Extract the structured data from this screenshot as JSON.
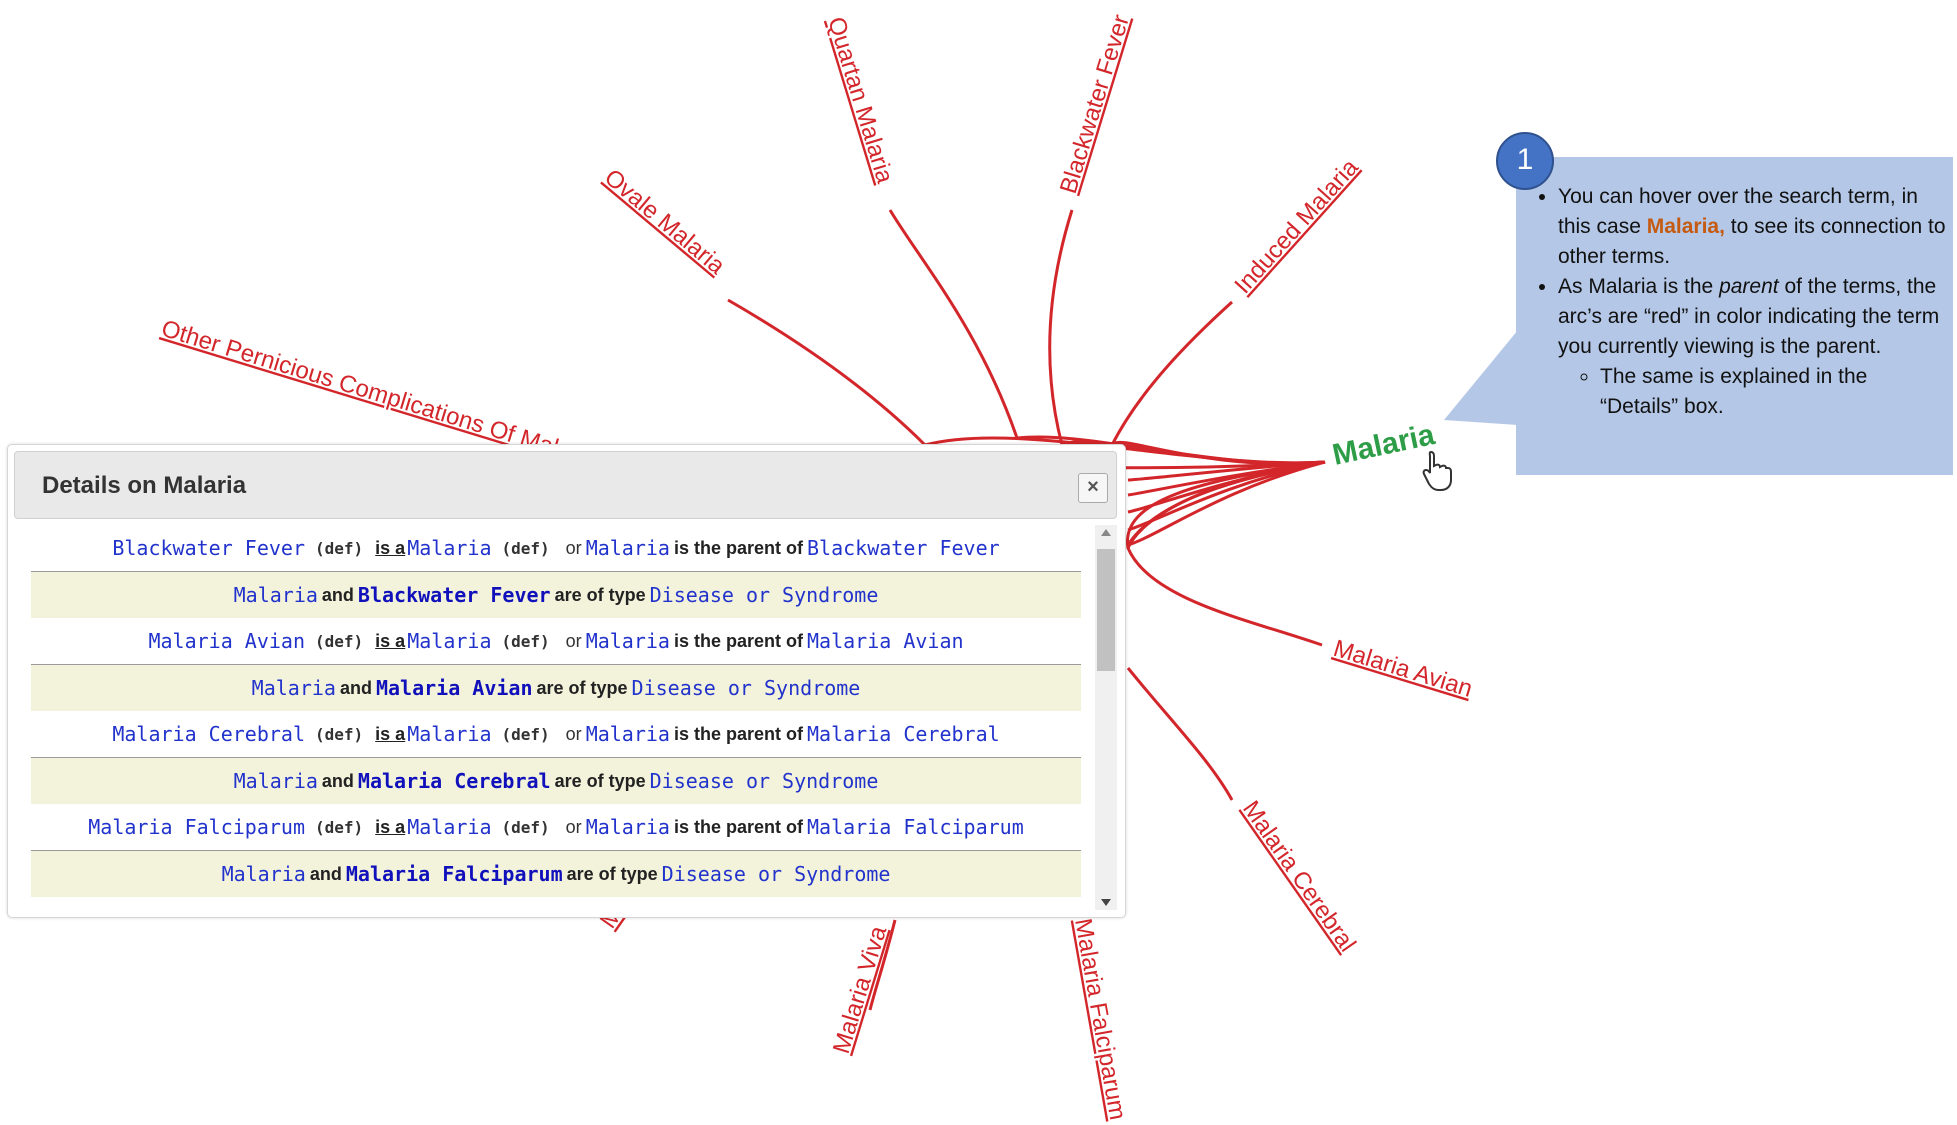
{
  "graph": {
    "center": "Malaria",
    "nodes": [
      "Quartan Malaria",
      "Blackwater Fever",
      "Induced Malaria",
      "Ovale Malaria",
      "Other Pernicious Complications Of Mala",
      "Malaria Avian",
      "Malaria Cerebral",
      "Malaria Falciparum",
      "Malaria Viva",
      "M"
    ],
    "edge_color": "#d3262b",
    "center_color": "#2e9d47"
  },
  "details": {
    "title": "Details on Malaria",
    "close": "×",
    "rows": [
      {
        "a": "Blackwater Fever",
        "def": "(def)",
        "rel": "is a",
        "b": "Malaria",
        "def2": "(def)",
        "or": "or",
        "c": "Malaria",
        "parent": "is the parent of",
        "d": "Blackwater Fever"
      },
      {
        "a": "Malaria",
        "and": "and",
        "b": "Blackwater Fever",
        "type": "are of type",
        "c": "Disease or Syndrome"
      },
      {
        "a": "Malaria Avian",
        "def": "(def)",
        "rel": "is a",
        "b": "Malaria",
        "def2": "(def)",
        "or": "or",
        "c": "Malaria",
        "parent": "is the parent of",
        "d": "Malaria Avian"
      },
      {
        "a": "Malaria",
        "and": "and",
        "b": "Malaria Avian",
        "type": "are of type",
        "c": "Disease or Syndrome"
      },
      {
        "a": "Malaria Cerebral",
        "def": "(def)",
        "rel": "is a",
        "b": "Malaria",
        "def2": "(def)",
        "or": "or",
        "c": "Malaria",
        "parent": "is the parent of",
        "d": "Malaria Cerebral"
      },
      {
        "a": "Malaria",
        "and": "and",
        "b": "Malaria Cerebral",
        "type": "are of type",
        "c": "Disease or Syndrome"
      },
      {
        "a": "Malaria Falciparum",
        "def": "(def)",
        "rel": "is a",
        "b": "Malaria",
        "def2": "(def)",
        "or": "or",
        "c": "Malaria",
        "parent": "is the parent of",
        "d": "Malaria Falciparum"
      },
      {
        "a": "Malaria",
        "and": "and",
        "b": "Malaria Falciparum",
        "type": "are of type",
        "c": "Disease or Syndrome"
      }
    ]
  },
  "callout": {
    "number": "1",
    "b1_pre": "You can hover over the search term, in this case ",
    "b1_hl": "Malaria,",
    "b1_post": " to see its connection to other terms.",
    "b2_pre": "As Malaria is the ",
    "b2_em": "parent",
    "b2_post": " of the terms, the arc’s are “red” in color indicating the term you currently viewing is the parent.",
    "b3": "The same is explained in the “Details” box.",
    "bg_color": "#b4c7e7"
  }
}
